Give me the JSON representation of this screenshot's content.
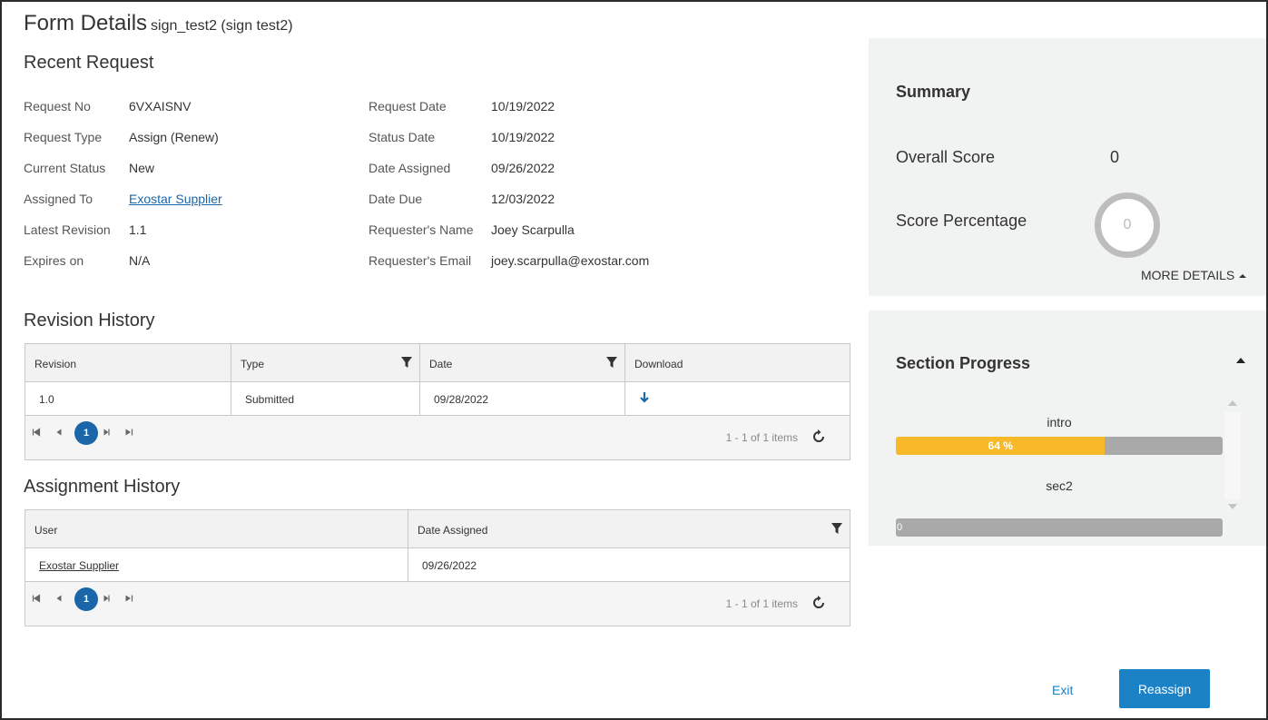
{
  "header": {
    "title": "Form Details",
    "subtitle": "sign_test2 (sign test2)"
  },
  "recent_request": {
    "heading": "Recent Request",
    "left": [
      {
        "label": "Request No",
        "value": "6VXAISNV"
      },
      {
        "label": "Request Type",
        "value": "Assign (Renew)"
      },
      {
        "label": "Current Status",
        "value": "New"
      },
      {
        "label": "Assigned To",
        "value": "Exostar Supplier"
      },
      {
        "label": "Latest Revision",
        "value": "1.1"
      },
      {
        "label": "Expires on",
        "value": "N/A"
      }
    ],
    "right": [
      {
        "label": "Request Date",
        "value": "10/19/2022"
      },
      {
        "label": "Status Date",
        "value": "10/19/2022"
      },
      {
        "label": "Date Assigned",
        "value": "09/26/2022"
      },
      {
        "label": "Date Due",
        "value": "12/03/2022"
      },
      {
        "label": "Requester's Name",
        "value": "Joey Scarpulla"
      },
      {
        "label": "Requester's Email",
        "value": "joey.scarpulla@exostar.com"
      }
    ]
  },
  "revision_history": {
    "heading": "Revision History",
    "columns": [
      "Revision",
      "Type",
      "Date",
      "Download"
    ],
    "rows": [
      {
        "revision": "1.0",
        "type": "Submitted",
        "date": "09/28/2022"
      }
    ],
    "page": "1",
    "info": "1 - 1 of 1 items"
  },
  "assignment_history": {
    "heading": "Assignment History",
    "columns": [
      "User",
      "Date Assigned"
    ],
    "rows": [
      {
        "user": "Exostar Supplier",
        "date": "09/26/2022"
      }
    ],
    "page": "1",
    "info": "1 - 1 of 1 items"
  },
  "summary": {
    "title": "Summary",
    "overall_score_label": "Overall Score",
    "overall_score": "0",
    "score_percentage_label": "Score Percentage",
    "score_percentage": "0",
    "more_details": "MORE DETAILS"
  },
  "section_progress": {
    "title": "Section Progress",
    "sections": [
      {
        "name": "intro",
        "percent": 64,
        "label": "64 %"
      },
      {
        "name": "sec2",
        "percent": 0,
        "label": "0"
      }
    ]
  },
  "actions": {
    "exit": "Exit",
    "reassign": "Reassign"
  },
  "colors": {
    "accent": "#1b82c6",
    "progress": "#f7b928",
    "panel": "#f1f2f2"
  }
}
